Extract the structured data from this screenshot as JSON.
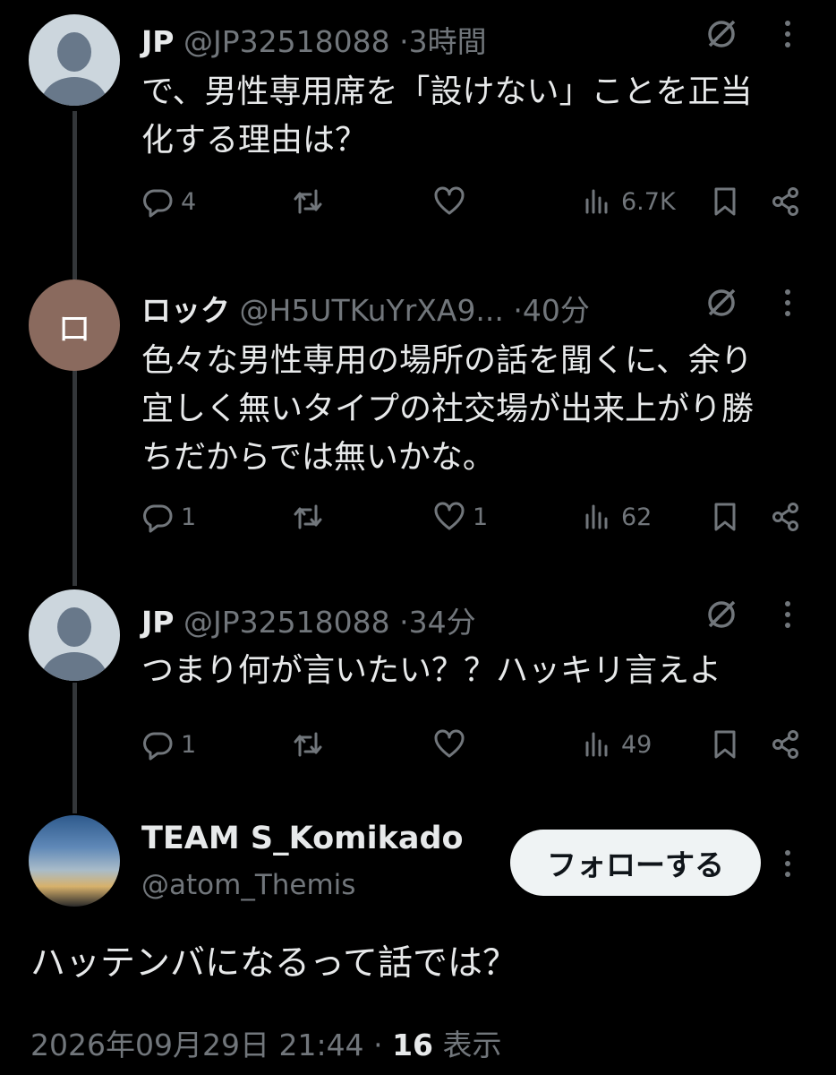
{
  "replies": [
    {
      "name": "JP",
      "handle": "@JP32518088",
      "time": "3時間",
      "text_lines": [
        "で、男性専用席を「設けない」ことを正当",
        "化する理由は？"
      ],
      "reply_count": "4",
      "retweet_count": "",
      "like_count": "",
      "view_count": "6.7K",
      "avatar": "default-avatar"
    },
    {
      "name": "ロック",
      "handle": "@H5UTKuYrXA9...",
      "time": "40分",
      "avatar_letter": "ロ",
      "text_lines": [
        "色々な男性専用の場所の話を聞くに、余り",
        "宜しく無いタイプの社交場が出来上がり勝",
        "ちだからでは無いかな。"
      ],
      "reply_count": "1",
      "retweet_count": "",
      "like_count": "1",
      "view_count": "62"
    },
    {
      "name": "JP",
      "handle": "@JP32518088",
      "time": "34分",
      "text_lines": [
        "つまり何が言いたい？？ハッキリ言えよ"
      ],
      "reply_count": "1",
      "retweet_count": "",
      "like_count": "",
      "view_count": "49",
      "avatar": "default-avatar"
    }
  ],
  "main_tweet": {
    "name": "TEAM S_Komikado",
    "handle": "@atom_Themis",
    "follow_label": "フォローする",
    "text": "ハッテンバになるって話では？",
    "date": "2026年09月29日 21:44",
    "separator": "·",
    "views": "16",
    "views_label": "表示"
  },
  "colors": {
    "background": "#000000",
    "text": "#e7e9ea",
    "muted": "#71767b",
    "thread_line": "#333639"
  },
  "icons": [
    "reply-icon",
    "retweet-icon",
    "like-icon",
    "views-icon",
    "bookmark-icon",
    "share-icon",
    "grok-icon",
    "more-icon"
  ]
}
